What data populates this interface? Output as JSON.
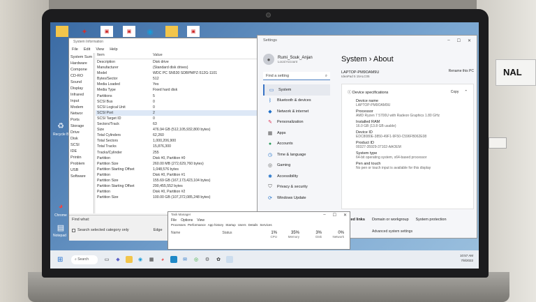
{
  "physical": {
    "sticker_text": "NAL"
  },
  "desktop": {
    "icons": [
      {
        "label": "Recycle B",
        "icon": "recycle-bin-icon"
      },
      {
        "label": "Chrome",
        "icon": "chrome-icon"
      },
      {
        "label": "Notepad",
        "icon": "notepad-icon"
      }
    ]
  },
  "sysinfo": {
    "title": "System Information",
    "menu": [
      "File",
      "Edit",
      "View",
      "Help"
    ],
    "tree": [
      "System Sum",
      "Hardware",
      "Compone",
      "CD-RO",
      "Sound",
      "Display",
      "Infrared",
      "Input",
      "Modem",
      "Networ",
      "Ports",
      "Storage",
      "Drive",
      "Disk",
      "SCSI",
      "IDE",
      "Printin",
      "Problem",
      "USB",
      "Software"
    ],
    "columns": {
      "item": "Item",
      "value": "Value"
    },
    "rows": [
      {
        "item": "Description",
        "value": "Disk drive"
      },
      {
        "item": "Manufacturer",
        "value": "(Standard disk drives)"
      },
      {
        "item": "Model",
        "value": "WDC PC SN530 SDBPMPZ-512G-1101"
      },
      {
        "item": "Bytes/Sector",
        "value": "512"
      },
      {
        "item": "Media Loaded",
        "value": "Yes"
      },
      {
        "item": "Media Type",
        "value": "Fixed hard disk"
      },
      {
        "item": "Partitions",
        "value": "5"
      },
      {
        "item": "SCSI Bus",
        "value": "0"
      },
      {
        "item": "SCSI Logical Unit",
        "value": "0"
      },
      {
        "item": "SCSI Port",
        "value": "2"
      },
      {
        "item": "SCSI Target ID",
        "value": "0"
      },
      {
        "item": "Sectors/Track",
        "value": "63"
      },
      {
        "item": "Size",
        "value": "476.94 GB (512,105,932,800 bytes)"
      },
      {
        "item": "Total Cylinders",
        "value": "62,260"
      },
      {
        "item": "Total Sectors",
        "value": "1,000,206,900"
      },
      {
        "item": "Total Tracks",
        "value": "15,876,300"
      },
      {
        "item": "Tracks/Cylinder",
        "value": "255"
      },
      {
        "item": "Partition",
        "value": "Disk #0, Partition #0"
      },
      {
        "item": "Partition Size",
        "value": "260.00 MB (272,629,760 bytes)"
      },
      {
        "item": "Partition Starting Offset",
        "value": "1,048,576 bytes"
      },
      {
        "item": "Partition",
        "value": "Disk #0, Partition #1"
      },
      {
        "item": "Partition Size",
        "value": "155.69 GB (167,173,423,104 bytes)"
      },
      {
        "item": "Partition Starting Offset",
        "value": "290,455,552 bytes"
      },
      {
        "item": "Partition",
        "value": "Disk #0, Partition #2"
      },
      {
        "item": "Partition Size",
        "value": "100.00 GB (107,372,085,248 bytes)"
      }
    ],
    "selected_row": 9,
    "find_label": "Find what:",
    "search_selected": "Search selected category only",
    "edge_text": "Edge"
  },
  "settings": {
    "title": "Settings",
    "user_name": "Rumi_Souk_Anjan",
    "user_account": "Local Account",
    "search_placeholder": "Find a setting",
    "nav": [
      {
        "label": "System",
        "icon": "system-icon"
      },
      {
        "label": "Bluetooth & devices",
        "icon": "bluetooth-icon"
      },
      {
        "label": "Network & internet",
        "icon": "wifi-icon"
      },
      {
        "label": "Personalization",
        "icon": "brush-icon"
      },
      {
        "label": "Apps",
        "icon": "apps-icon"
      },
      {
        "label": "Accounts",
        "icon": "account-icon"
      },
      {
        "label": "Time & language",
        "icon": "globe-icon"
      },
      {
        "label": "Gaming",
        "icon": "gaming-icon"
      },
      {
        "label": "Accessibility",
        "icon": "accessibility-icon"
      },
      {
        "label": "Privacy & security",
        "icon": "shield-icon"
      },
      {
        "label": "Windows Update",
        "icon": "update-icon"
      }
    ],
    "breadcrumb_parent": "System",
    "breadcrumb_sep": "›",
    "breadcrumb_current": "About",
    "device_name_short": "LAPTOP-PM9OAM9U",
    "device_model": "IdeaPad 5 15ALC05",
    "rename_label": "Rename this PC",
    "specs_title": "Device specifications",
    "copy_label": "Copy",
    "specs": [
      {
        "label": "Device name",
        "value": "LAPTOP-PM9OAM9U"
      },
      {
        "label": "Processor",
        "value": "AMD Ryzen 7 5700U with Radeon Graphics 1.80 GHz"
      },
      {
        "label": "Installed RAM",
        "value": "16.0 GB (13.8 GB usable)"
      },
      {
        "label": "Device ID",
        "value": "EDC8080E-3850-49F1-9F50-C596FB062E08"
      },
      {
        "label": "Product ID",
        "value": "00327-35929-37102-AAOEM"
      },
      {
        "label": "System type",
        "value": "64-bit operating system, x64-based processor"
      },
      {
        "label": "Pen and touch",
        "value": "No pen or touch input is available for this display"
      }
    ],
    "related_links": [
      "Related links",
      "Domain or workgroup",
      "System protection"
    ],
    "advanced_link": "Advanced system settings"
  },
  "taskmgr": {
    "title": "Task Manager",
    "menu": [
      "File",
      "Options",
      "View"
    ],
    "tabs": [
      "Processes",
      "Performance",
      "App history",
      "Startup",
      "Users",
      "Details",
      "Services"
    ],
    "col_name": "Name",
    "col_status": "Status",
    "metrics": [
      {
        "pct": "1%",
        "label": "CPU"
      },
      {
        "pct": "35%",
        "label": "Memory"
      },
      {
        "pct": "3%",
        "label": "Disk"
      },
      {
        "pct": "0%",
        "label": "Network"
      }
    ]
  },
  "taskbar": {
    "search_label": "Search",
    "time": "10:57 AM",
    "date": "7/8/2022"
  },
  "colors": {
    "accent": "#3873c5",
    "desktop": "#5f8fc2"
  }
}
